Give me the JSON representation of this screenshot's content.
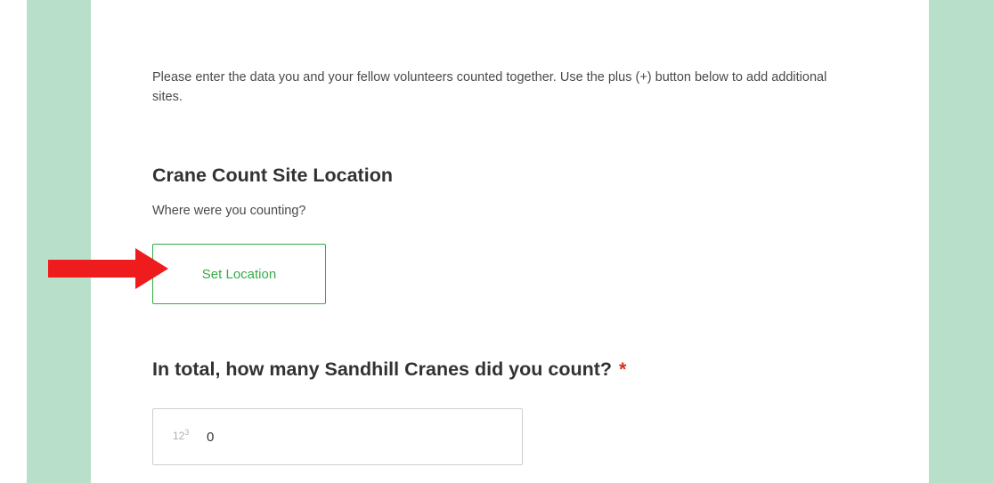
{
  "theme": {
    "side_panel_color": "#b8dfc9",
    "accent_green": "#35ac46",
    "required_red": "#d83020",
    "arrow_red": "#ee1c1c"
  },
  "form": {
    "intro_text": "Please enter the data you and your fellow volunteers counted together. Use the plus (+) button below to add additional sites.",
    "site_location": {
      "title": "Crane Count Site Location",
      "description": "Where were you counting?",
      "button_label": "Set Location"
    },
    "crane_count": {
      "question": "In total, how many Sandhill Cranes did you count?",
      "required_marker": "*",
      "value": "0",
      "icon": "number-input-icon",
      "icon_text": "12",
      "icon_superscript": "3"
    }
  },
  "annotation": {
    "icon": "red-arrow-annotation"
  }
}
